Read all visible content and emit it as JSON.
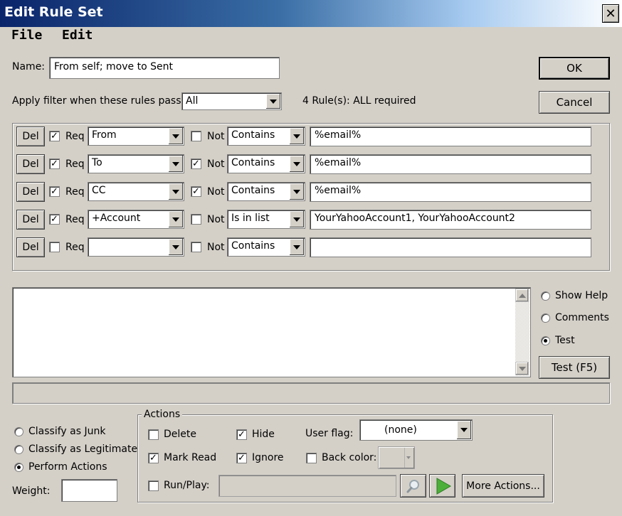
{
  "window": {
    "title": "Edit Rule Set",
    "close_glyph": "✕"
  },
  "menu": [
    "File",
    "Edit"
  ],
  "name_label": "Name:",
  "name_value": "From self; move to Sent",
  "buttons": {
    "ok": "OK",
    "cancel": "Cancel",
    "test": "Test (F5)",
    "more_actions": "More Actions..."
  },
  "apply_label": "Apply filter when these rules pass:",
  "apply_value": "All",
  "rules_summary": "4 Rule(s): ALL required",
  "rules": [
    {
      "del": "Del",
      "req_checked": true,
      "req_label": "Req",
      "field": "From",
      "not_checked": false,
      "not_label": "Not",
      "op": "Contains",
      "value": "%email%"
    },
    {
      "del": "Del",
      "req_checked": true,
      "req_label": "Req",
      "field": "To",
      "not_checked": true,
      "not_label": "Not",
      "op": "Contains",
      "value": "%email%"
    },
    {
      "del": "Del",
      "req_checked": true,
      "req_label": "Req",
      "field": "CC",
      "not_checked": true,
      "not_label": "Not",
      "op": "Contains",
      "value": "%email%"
    },
    {
      "del": "Del",
      "req_checked": true,
      "req_label": "Req",
      "field": "+Account",
      "not_checked": false,
      "not_label": "Not",
      "op": "Is in list",
      "value": "YourYahooAccount1, YourYahooAccount2"
    },
    {
      "del": "Del",
      "req_checked": false,
      "req_label": "Req",
      "field": "",
      "not_checked": false,
      "not_label": "Not",
      "op": "Contains",
      "value": ""
    }
  ],
  "view_options": [
    {
      "label": "Show Help",
      "selected": false
    },
    {
      "label": "Comments",
      "selected": false
    },
    {
      "label": "Test",
      "selected": true
    }
  ],
  "classify_options": [
    {
      "label": "Classify as Junk",
      "selected": false
    },
    {
      "label": "Classify as Legitimate",
      "selected": false
    },
    {
      "label": "Perform Actions",
      "selected": true
    }
  ],
  "weight_label": "Weight:",
  "weight_value": "",
  "actions": {
    "group_label": "Actions",
    "delete": {
      "label": "Delete",
      "checked": false
    },
    "hide": {
      "label": "Hide",
      "checked": true
    },
    "mark_read": {
      "label": "Mark Read",
      "checked": true
    },
    "ignore": {
      "label": "Ignore",
      "checked": true
    },
    "back_color": {
      "label": "Back color:",
      "checked": false
    },
    "run_play": {
      "label": "Run/Play:",
      "checked": false
    },
    "user_flag_label": "User flag:",
    "user_flag_value": "(none)",
    "run_path": ""
  },
  "icons": {
    "check": "✓",
    "browse": "magnifier-icon",
    "play": "play-icon"
  },
  "colors": {
    "title_start": "#0a246a",
    "title_end": "#ffffff",
    "face": "#d4d0c8",
    "play_green": "#4caf3a"
  }
}
